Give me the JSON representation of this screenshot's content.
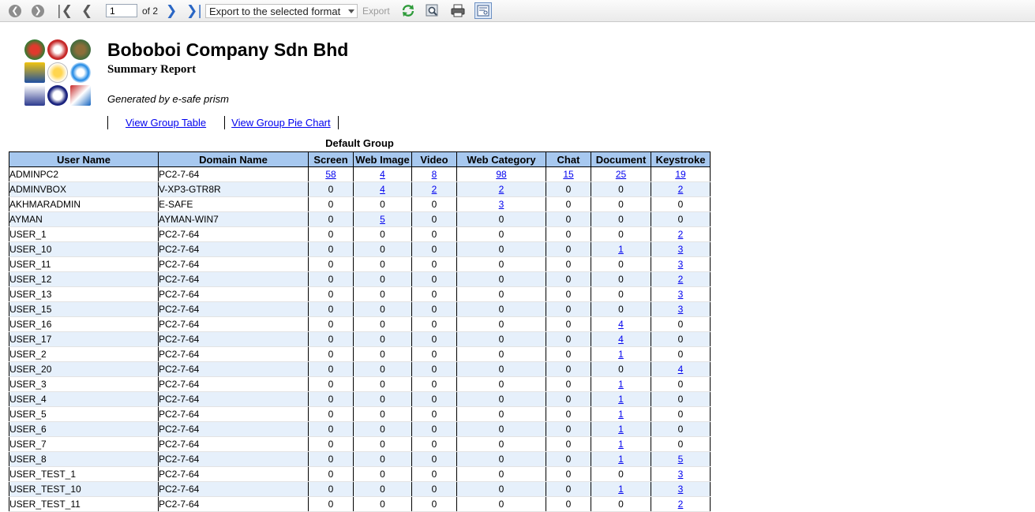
{
  "toolbar": {
    "page_value": "1",
    "page_of": "of 2",
    "export_format": "Export to the selected format",
    "export_label": "Export",
    "icons": [
      "first-page-circle-icon",
      "next-circle-icon",
      "first-page-icon",
      "previous-page-icon",
      "next-page-icon",
      "last-page-icon",
      "refresh-icon",
      "zoom-icon",
      "print-icon",
      "layout-icon"
    ]
  },
  "header": {
    "company": "Boboboi Company Sdn Bhd",
    "subtitle": "Summary Report",
    "generated_by": "Generated by e-safe prism",
    "links": [
      "View Group Table",
      "View Group Pie Chart"
    ]
  },
  "table": {
    "group_title": "Default Group",
    "columns": [
      "User Name",
      "Domain Name",
      "Screen",
      "Web Image",
      "Video",
      "Web Category",
      "Chat",
      "Document",
      "Keystroke"
    ],
    "rows": [
      [
        "ADMINPC2",
        "PC2-7-64",
        "58",
        "4",
        "8",
        "98",
        "15",
        "25",
        "19"
      ],
      [
        "ADMINVBOX",
        "V-XP3-GTR8R",
        "0",
        "4",
        "2",
        "2",
        "0",
        "0",
        "2"
      ],
      [
        "AKHMARADMIN",
        "E-SAFE",
        "0",
        "0",
        "0",
        "3",
        "0",
        "0",
        "0"
      ],
      [
        "AYMAN",
        "AYMAN-WIN7",
        "0",
        "5",
        "0",
        "0",
        "0",
        "0",
        "0"
      ],
      [
        "USER_1",
        "PC2-7-64",
        "0",
        "0",
        "0",
        "0",
        "0",
        "0",
        "2"
      ],
      [
        "USER_10",
        "PC2-7-64",
        "0",
        "0",
        "0",
        "0",
        "0",
        "1",
        "3"
      ],
      [
        "USER_11",
        "PC2-7-64",
        "0",
        "0",
        "0",
        "0",
        "0",
        "0",
        "3"
      ],
      [
        "USER_12",
        "PC2-7-64",
        "0",
        "0",
        "0",
        "0",
        "0",
        "0",
        "2"
      ],
      [
        "USER_13",
        "PC2-7-64",
        "0",
        "0",
        "0",
        "0",
        "0",
        "0",
        "3"
      ],
      [
        "USER_15",
        "PC2-7-64",
        "0",
        "0",
        "0",
        "0",
        "0",
        "0",
        "3"
      ],
      [
        "USER_16",
        "PC2-7-64",
        "0",
        "0",
        "0",
        "0",
        "0",
        "4",
        "0"
      ],
      [
        "USER_17",
        "PC2-7-64",
        "0",
        "0",
        "0",
        "0",
        "0",
        "4",
        "0"
      ],
      [
        "USER_2",
        "PC2-7-64",
        "0",
        "0",
        "0",
        "0",
        "0",
        "1",
        "0"
      ],
      [
        "USER_20",
        "PC2-7-64",
        "0",
        "0",
        "0",
        "0",
        "0",
        "0",
        "4"
      ],
      [
        "USER_3",
        "PC2-7-64",
        "0",
        "0",
        "0",
        "0",
        "0",
        "1",
        "0"
      ],
      [
        "USER_4",
        "PC2-7-64",
        "0",
        "0",
        "0",
        "0",
        "0",
        "1",
        "0"
      ],
      [
        "USER_5",
        "PC2-7-64",
        "0",
        "0",
        "0",
        "0",
        "0",
        "1",
        "0"
      ],
      [
        "USER_6",
        "PC2-7-64",
        "0",
        "0",
        "0",
        "0",
        "0",
        "1",
        "0"
      ],
      [
        "USER_7",
        "PC2-7-64",
        "0",
        "0",
        "0",
        "0",
        "0",
        "1",
        "0"
      ],
      [
        "USER_8",
        "PC2-7-64",
        "0",
        "0",
        "0",
        "0",
        "0",
        "1",
        "5"
      ],
      [
        "USER_TEST_1",
        "PC2-7-64",
        "0",
        "0",
        "0",
        "0",
        "0",
        "0",
        "3"
      ],
      [
        "USER_TEST_10",
        "PC2-7-64",
        "0",
        "0",
        "0",
        "0",
        "0",
        "1",
        "3"
      ],
      [
        "USER_TEST_11",
        "PC2-7-64",
        "0",
        "0",
        "0",
        "0",
        "0",
        "0",
        "2"
      ]
    ]
  }
}
